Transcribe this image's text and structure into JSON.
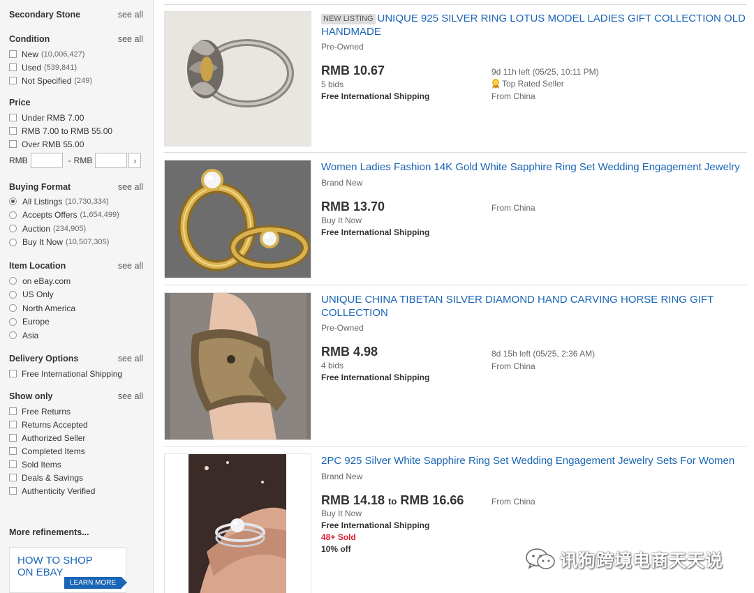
{
  "sidebar": {
    "see_all": "see all",
    "secondary_stone": {
      "title": "Secondary Stone"
    },
    "condition": {
      "title": "Condition",
      "options": [
        {
          "label": "New",
          "count": "(10,006,427)"
        },
        {
          "label": "Used",
          "count": "(539,841)"
        },
        {
          "label": "Not Specified",
          "count": "(249)"
        }
      ]
    },
    "price": {
      "title": "Price",
      "options": [
        {
          "label": "Under RMB 7.00"
        },
        {
          "label": "RMB 7.00 to RMB 55.00"
        },
        {
          "label": "Over RMB 55.00"
        }
      ],
      "min_label": "RMB",
      "dash": "-",
      "max_label": "RMB",
      "go": "›"
    },
    "buying_format": {
      "title": "Buying Format",
      "options": [
        {
          "label": "All Listings",
          "count": "(10,730,334)",
          "selected": true
        },
        {
          "label": "Accepts Offers",
          "count": "(1,654,499)",
          "selected": false
        },
        {
          "label": "Auction",
          "count": "(234,905)",
          "selected": false
        },
        {
          "label": "Buy It Now",
          "count": "(10,507,305)",
          "selected": false
        }
      ]
    },
    "item_location": {
      "title": "Item Location",
      "options": [
        {
          "label": "on eBay.com"
        },
        {
          "label": "US Only"
        },
        {
          "label": "North America"
        },
        {
          "label": "Europe"
        },
        {
          "label": "Asia"
        }
      ]
    },
    "delivery_options": {
      "title": "Delivery Options",
      "options": [
        {
          "label": "Free International Shipping"
        }
      ]
    },
    "show_only": {
      "title": "Show only",
      "options": [
        {
          "label": "Free Returns"
        },
        {
          "label": "Returns Accepted"
        },
        {
          "label": "Authorized Seller"
        },
        {
          "label": "Completed Items"
        },
        {
          "label": "Sold Items"
        },
        {
          "label": "Deals & Savings"
        },
        {
          "label": "Authenticity Verified"
        }
      ]
    },
    "more_refinements": "More refinements...",
    "ad": {
      "text": "HOW TO SHOP ON EBAY",
      "button": "LEARN MORE"
    }
  },
  "listings": [
    {
      "badge": "NEW LISTING",
      "title": "UNIQUE 925 SILVER RING LOTUS MODEL LADIES GIFT COLLECTION OLD HANDMADE",
      "condition": "Pre-Owned",
      "price": "RMB 10.67",
      "sub": "5 bids",
      "shipping": "Free International Shipping",
      "time_left": "9d 11h left (05/25, 10:11 PM)",
      "seller": "Top Rated Seller",
      "location": "From China",
      "image_icon": "silver-lotus-ring"
    },
    {
      "title": "Women Ladies Fashion 14K Gold White Sapphire Ring Set Wedding Engagement Jewelry",
      "condition": "Brand New",
      "price": "RMB 13.70",
      "sub": "Buy It Now",
      "shipping": "Free International Shipping",
      "location": "From China",
      "image_icon": "gold-sapphire-ring-set"
    },
    {
      "title": "UNIQUE CHINA TIBETAN SILVER DIAMOND HAND CARVING HORSE RING GIFT COLLECTION",
      "condition": "Pre-Owned",
      "price": "RMB 4.98",
      "sub": "4 bids",
      "shipping": "Free International Shipping",
      "time_left": "8d 15h left (05/25, 2:36 AM)",
      "location": "From China",
      "image_icon": "horse-ring-on-finger"
    },
    {
      "title": "2PC 925 Silver White Sapphire Ring Set Wedding Engagement Jewelry Sets For Women",
      "condition": "Brand New",
      "price_low": "RMB 14.18",
      "price_to": "to",
      "price_high": "RMB 16.66",
      "sub": "Buy It Now",
      "shipping": "Free International Shipping",
      "sold": "48+ Sold",
      "off": "10% off",
      "location": "From China",
      "image_icon": "silver-ring-set-on-hand"
    }
  ],
  "watermark": {
    "text": "讯狗跨境电商天天说",
    "icon": "wechat-icon"
  },
  "colors": {
    "link": "#1a65b5",
    "sold": "#dd1e31",
    "sidebar_bg": "#f5f5f5"
  }
}
